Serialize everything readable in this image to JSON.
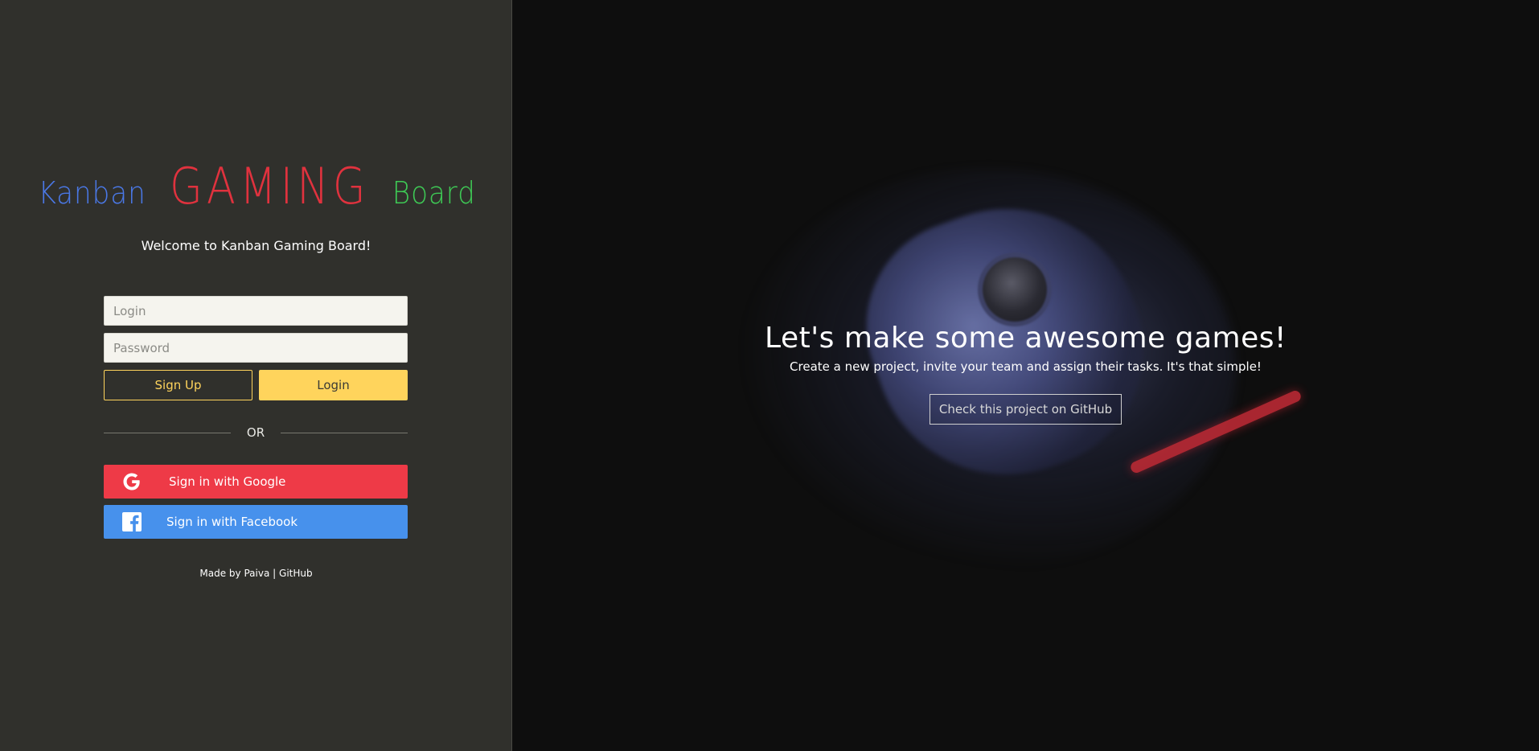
{
  "logo": {
    "word1": "Kanban",
    "word2": "GAMING",
    "word3": "Board"
  },
  "left": {
    "welcome": "Welcome to Kanban Gaming Board!",
    "login_placeholder": "Login",
    "password_placeholder": "Password",
    "signup_label": "Sign Up",
    "login_label": "Login",
    "or_text": "OR",
    "google_label": "Sign in with Google",
    "facebook_label": "Sign in with Facebook",
    "footer_prefix": "Made by",
    "footer_author": "Paiva",
    "footer_sep": "|",
    "footer_github": "GitHub"
  },
  "hero": {
    "title": "Let's make some awesome games!",
    "subtitle": "Create a new project, invite your team and assign their tasks. It's that simple!",
    "button_label": "Check this project on GitHub"
  },
  "colors": {
    "left_bg": "#30302c",
    "accent_yellow": "#ffd45c",
    "google_red": "#ee3a47",
    "facebook_blue": "#4791ec",
    "logo_blue": "#4a78e6",
    "logo_red": "#e0323e",
    "logo_green": "#3ec955"
  },
  "icons": {
    "google": "google-g-icon",
    "facebook": "facebook-f-icon"
  }
}
